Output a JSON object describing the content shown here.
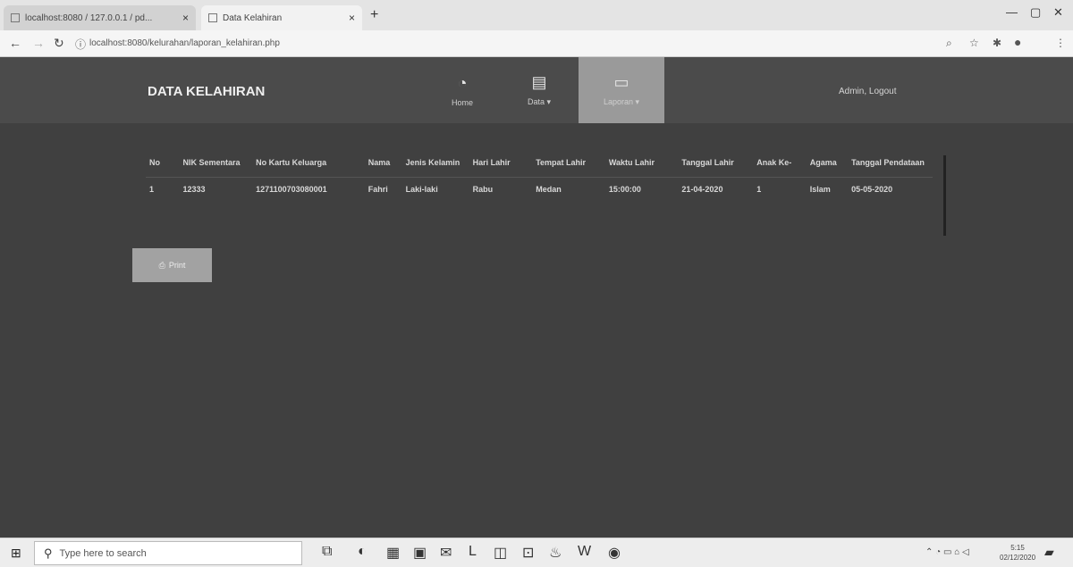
{
  "browser": {
    "tabs": [
      {
        "title": "localhost:8080 / 127.0.0.1 / pd..."
      },
      {
        "title": "Data Kelahiran"
      }
    ],
    "url": "localhost:8080/kelurahan/laporan_kelahiran.php"
  },
  "app": {
    "brand": "DATA KELAHIRAN",
    "nav": [
      {
        "label": "Home",
        "icon": "dashboard-icon"
      },
      {
        "label": "Data ▾",
        "icon": "document-icon"
      },
      {
        "label": "Laporan ▾",
        "icon": "laptop-icon"
      }
    ],
    "user_link": "Admin, Logout"
  },
  "table": {
    "headers": [
      "No",
      "NIK Sementara",
      "No Kartu Keluarga",
      "Nama",
      "Jenis Kelamin",
      "Hari Lahir",
      "Tempat Lahir",
      "Waktu Lahir",
      "Tanggal Lahir",
      "Anak Ke-",
      "Agama",
      "Tanggal Pendataan"
    ],
    "rows": [
      [
        "1",
        "12333",
        "1271100703080001",
        "Fahri",
        "Laki-laki",
        "Rabu",
        "Medan",
        "15:00:00",
        "21-04-2020",
        "1",
        "Islam",
        "05-05-2020"
      ]
    ]
  },
  "print_button": "Print",
  "taskbar": {
    "search_placeholder": "Type here to search",
    "time": "5:15",
    "date": "02/12/2020"
  }
}
